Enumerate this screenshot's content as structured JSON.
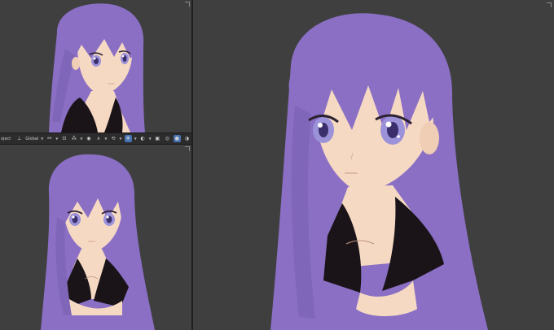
{
  "toolbar": {
    "mode_label": "oject",
    "orientation_label": "Global",
    "buttons": [
      "object-mode",
      "transform-orientation",
      "pivot",
      "snap",
      "proportional",
      "overlay",
      "xray",
      "shading-wire",
      "shading-solid",
      "shading-material",
      "shading-rendered"
    ]
  },
  "viewports": [
    {
      "name": "top-left",
      "content": "character-3-4-view"
    },
    {
      "name": "bottom-left",
      "content": "character-front-view"
    },
    {
      "name": "right",
      "content": "character-closeup"
    }
  ],
  "colors": {
    "viewport_bg": "#3f3f3f",
    "hair": "#8a6fc4",
    "skin": "#f6d9c3",
    "collar": "#1a1419",
    "eye": "#9b92d9",
    "active_button": "#4772b3"
  }
}
